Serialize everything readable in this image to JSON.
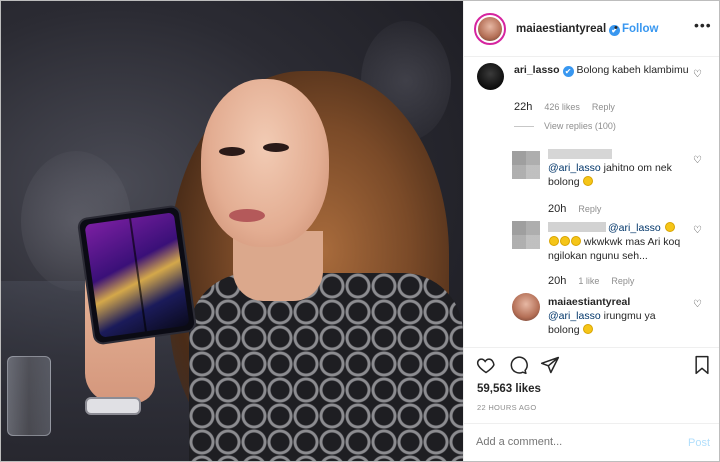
{
  "header": {
    "username": "maiaestiantyreal",
    "verified_icon": "✔",
    "separator": "•",
    "follow_label": "Follow",
    "more_icon": "•••"
  },
  "comments": [
    {
      "username": "ari_lasso",
      "verified_icon": "✔",
      "text": "Bolong kabeh klambimu",
      "time": "22h",
      "likes": "426 likes",
      "reply": "Reply",
      "view_replies": "View replies (100)"
    },
    {
      "mention": "@ari_lasso",
      "text": "jahitno om nek bolong",
      "time": "20h",
      "reply": "Reply"
    },
    {
      "mention": "@ari_lasso",
      "text": "wkwkwk mas Ari koq ngilokan ngunu seh...",
      "time": "20h",
      "likes": "1 like",
      "reply": "Reply"
    },
    {
      "username": "maiaestiantyreal",
      "mention": "@ari_lasso",
      "text": "irungmu ya bolong"
    }
  ],
  "actions": {
    "like_icon": "heart-icon",
    "comment_icon": "comment-icon",
    "share_icon": "share-icon",
    "save_icon": "bookmark-icon"
  },
  "likes_count": "59,563 likes",
  "time_ago": "22 HOURS AGO",
  "add_comment": {
    "placeholder": "Add a comment...",
    "post_label": "Post"
  },
  "colors": {
    "accent": "#3897f0",
    "mention": "#003569",
    "muted": "#8e8e8e",
    "post_disabled": "#b2dffc"
  }
}
